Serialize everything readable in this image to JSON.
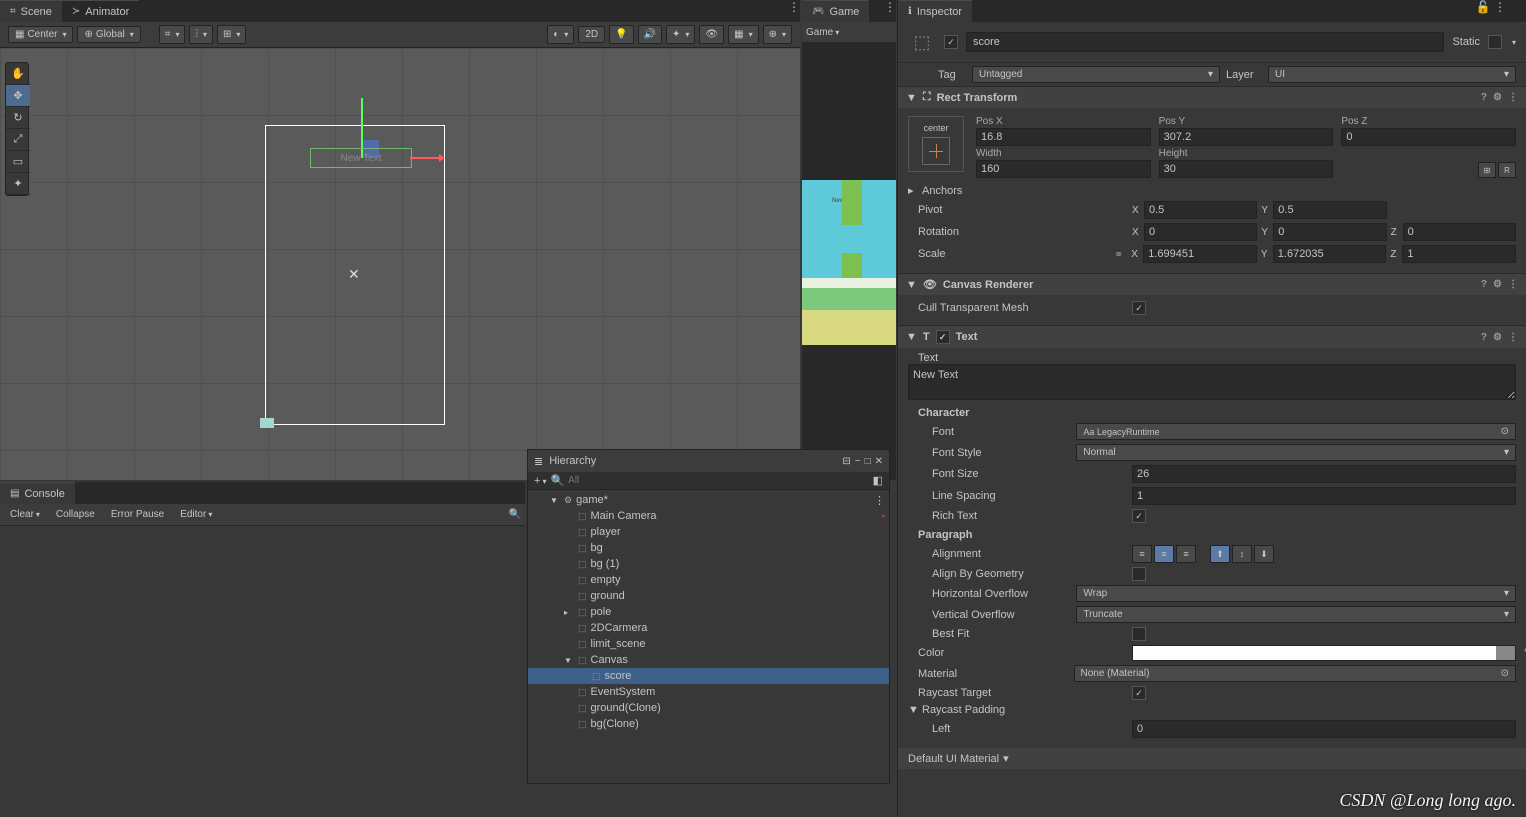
{
  "scene": {
    "tab_scene": "Scene",
    "tab_animator": "Animator",
    "center": "Center",
    "global": "Global",
    "mode_2d": "2D",
    "text_label": "New Text"
  },
  "game": {
    "tab": "Game",
    "dropdown": "Game",
    "preview_text": "New Text"
  },
  "console": {
    "tab": "Console",
    "clear": "Clear",
    "collapse": "Collapse",
    "error_pause": "Error Pause",
    "editor": "Editor"
  },
  "hierarchy": {
    "title": "Hierarchy",
    "search_placeholder": "All",
    "items": [
      {
        "name": "game*",
        "depth": 0,
        "type": "scene",
        "expanded": true
      },
      {
        "name": "Main Camera",
        "depth": 1
      },
      {
        "name": "player",
        "depth": 1
      },
      {
        "name": "bg",
        "depth": 1
      },
      {
        "name": "bg (1)",
        "depth": 1
      },
      {
        "name": "empty",
        "depth": 1
      },
      {
        "name": "ground",
        "depth": 1
      },
      {
        "name": "pole",
        "depth": 1,
        "arrow": true
      },
      {
        "name": "2DCarmera",
        "depth": 1
      },
      {
        "name": "limit_scene",
        "depth": 1
      },
      {
        "name": "Canvas",
        "depth": 1,
        "expanded": true
      },
      {
        "name": "score",
        "depth": 2,
        "selected": true
      },
      {
        "name": "EventSystem",
        "depth": 1
      },
      {
        "name": "ground(Clone)",
        "depth": 1
      },
      {
        "name": "bg(Clone)",
        "depth": 1
      }
    ]
  },
  "inspector": {
    "tab": "Inspector",
    "object_name": "score",
    "static_label": "Static",
    "tag_label": "Tag",
    "tag_value": "Untagged",
    "layer_label": "Layer",
    "layer_value": "UI",
    "rect_transform": {
      "title": "Rect Transform",
      "anchor_h": "center",
      "anchor_v": "middle",
      "pos_x_label": "Pos X",
      "pos_x": "16.8",
      "pos_y_label": "Pos Y",
      "pos_y": "307.2",
      "pos_z_label": "Pos Z",
      "pos_z": "0",
      "width_label": "Width",
      "width": "160",
      "height_label": "Height",
      "height": "30",
      "anchors": "Anchors",
      "pivot": "Pivot",
      "pivot_x": "0.5",
      "pivot_y": "0.5",
      "rotation": "Rotation",
      "rot_x": "0",
      "rot_y": "0",
      "rot_z": "0",
      "scale": "Scale",
      "scale_x": "1.699451",
      "scale_y": "1.672035",
      "scale_z": "1",
      "blueprint_r": "R"
    },
    "canvas_renderer": {
      "title": "Canvas Renderer",
      "cull": "Cull Transparent Mesh"
    },
    "text": {
      "title": "Text",
      "text_label": "Text",
      "text_value": "New Text",
      "character": "Character",
      "font": "Font",
      "font_value": "LegacyRuntime",
      "font_style": "Font Style",
      "font_style_value": "Normal",
      "font_size": "Font Size",
      "font_size_value": "26",
      "line_spacing": "Line Spacing",
      "line_spacing_value": "1",
      "rich_text": "Rich Text",
      "paragraph": "Paragraph",
      "alignment": "Alignment",
      "align_by_geometry": "Align By Geometry",
      "h_overflow": "Horizontal Overflow",
      "h_overflow_value": "Wrap",
      "v_overflow": "Vertical Overflow",
      "v_overflow_value": "Truncate",
      "best_fit": "Best Fit",
      "color": "Color",
      "material": "Material",
      "material_value": "None (Material)",
      "raycast_target": "Raycast Target",
      "raycast_padding": "Raycast Padding",
      "left": "Left",
      "left_value": "0"
    },
    "default_material": "Default UI Material"
  },
  "watermark": "CSDN @Long long ago."
}
